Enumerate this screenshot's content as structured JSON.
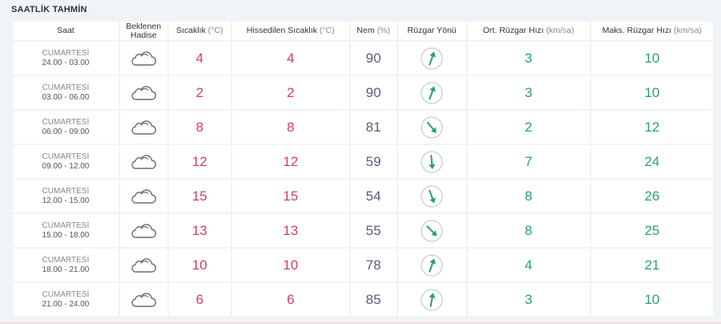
{
  "page": {
    "title": "SAATLİK TAHMİN"
  },
  "headers": {
    "saat": "Saat",
    "hadise": "Beklenen Hadise",
    "sicaklik": "Sıcaklık",
    "sicaklik_unit": "(°C)",
    "hissedilen": "Hissedilen Sıcaklık",
    "hissedilen_unit": "(°C)",
    "nem": "Nem",
    "nem_unit": "(%)",
    "ruzgar_yonu": "Rüzgar Yönü",
    "ort_ruzgar": "Ort. Rüzgar Hızı",
    "ort_ruzgar_unit": "(km/sa)",
    "maks_ruzgar": "Maks. Rüzgar Hızı",
    "maks_ruzgar_unit": "(km/sa)"
  },
  "colors": {
    "temp": "#d2405c",
    "humidity": "#56607a",
    "wind": "#2a9d7a"
  },
  "rows": [
    {
      "day": "CUMARTESİ",
      "range": "24.00 - 03.00",
      "icon": "cloud-icon",
      "temp": "4",
      "feels": "4",
      "humidity": "90",
      "wind_dir_deg": 200,
      "wind_avg": "3",
      "wind_max": "10"
    },
    {
      "day": "CUMARTESİ",
      "range": "03.00 - 06.00",
      "icon": "cloud-icon",
      "temp": "2",
      "feels": "2",
      "humidity": "90",
      "wind_dir_deg": 200,
      "wind_avg": "3",
      "wind_max": "10"
    },
    {
      "day": "CUMARTESİ",
      "range": "06.00 - 09.00",
      "icon": "cloud-icon",
      "temp": "8",
      "feels": "8",
      "humidity": "81",
      "wind_dir_deg": 320,
      "wind_avg": "2",
      "wind_max": "12"
    },
    {
      "day": "CUMARTESİ",
      "range": "09.00 - 12.00",
      "icon": "cloud-icon",
      "temp": "12",
      "feels": "12",
      "humidity": "59",
      "wind_dir_deg": 355,
      "wind_avg": "7",
      "wind_max": "24"
    },
    {
      "day": "CUMARTESİ",
      "range": "12.00 - 15.00",
      "icon": "cloud-icon",
      "temp": "15",
      "feels": "15",
      "humidity": "54",
      "wind_dir_deg": 340,
      "wind_avg": "8",
      "wind_max": "26"
    },
    {
      "day": "CUMARTESİ",
      "range": "15.00 - 18.00",
      "icon": "cloud-icon",
      "temp": "13",
      "feels": "13",
      "humidity": "55",
      "wind_dir_deg": 315,
      "wind_avg": "8",
      "wind_max": "25"
    },
    {
      "day": "CUMARTESİ",
      "range": "18.00 - 21.00",
      "icon": "cloud-icon",
      "temp": "10",
      "feels": "10",
      "humidity": "78",
      "wind_dir_deg": 200,
      "wind_avg": "4",
      "wind_max": "21"
    },
    {
      "day": "CUMARTESİ",
      "range": "21.00 - 24.00",
      "icon": "cloud-icon",
      "temp": "6",
      "feels": "6",
      "humidity": "85",
      "wind_dir_deg": 190,
      "wind_avg": "3",
      "wind_max": "10"
    }
  ]
}
